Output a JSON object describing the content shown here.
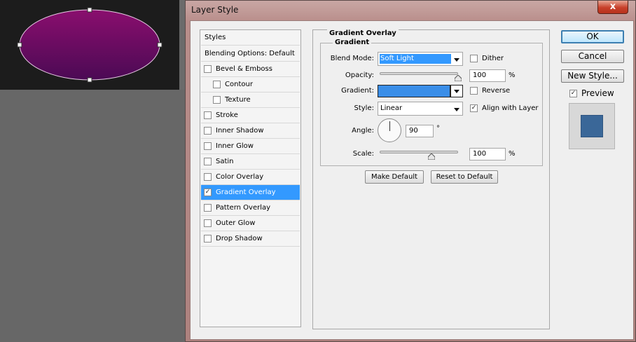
{
  "dialog": {
    "title": "Layer Style",
    "close_glyph": "x"
  },
  "sidebar": {
    "header": "Styles",
    "blending": "Blending Options: Default",
    "items": [
      {
        "label": "Bevel & Emboss",
        "checked": false,
        "indent": false
      },
      {
        "label": "Contour",
        "checked": false,
        "indent": true
      },
      {
        "label": "Texture",
        "checked": false,
        "indent": true
      },
      {
        "label": "Stroke",
        "checked": false,
        "indent": false
      },
      {
        "label": "Inner Shadow",
        "checked": false,
        "indent": false
      },
      {
        "label": "Inner Glow",
        "checked": false,
        "indent": false
      },
      {
        "label": "Satin",
        "checked": false,
        "indent": false
      },
      {
        "label": "Color Overlay",
        "checked": false,
        "indent": false
      },
      {
        "label": "Gradient Overlay",
        "checked": true,
        "indent": false,
        "selected": true
      },
      {
        "label": "Pattern Overlay",
        "checked": false,
        "indent": false
      },
      {
        "label": "Outer Glow",
        "checked": false,
        "indent": false
      },
      {
        "label": "Drop Shadow",
        "checked": false,
        "indent": false
      }
    ]
  },
  "panel": {
    "section_title": "Gradient Overlay",
    "group_title": "Gradient",
    "blend_mode_label": "Blend Mode:",
    "blend_mode_value": "Soft Light",
    "dither_label": "Dither",
    "opacity_label": "Opacity:",
    "opacity_value": "100",
    "opacity_percent": 100,
    "percent_sign": "%",
    "gradient_label": "Gradient:",
    "gradient_color": "#3a8ee8",
    "reverse_label": "Reverse",
    "style_label": "Style:",
    "style_value": "Linear",
    "align_label": "Align with Layer",
    "align_checked": true,
    "angle_label": "Angle:",
    "angle_value": "90",
    "degree_sign": "°",
    "scale_label": "Scale:",
    "scale_value": "100",
    "scale_percent": 100,
    "make_default": "Make Default",
    "reset_default": "Reset to Default"
  },
  "actions": {
    "ok": "OK",
    "cancel": "Cancel",
    "new_style": "New Style...",
    "preview_label": "Preview",
    "preview_checked": true,
    "preview_color": "#3a6798"
  },
  "canvas": {
    "shape_gradient_top": "#8a0e6e",
    "shape_gradient_bottom": "#4b0a54"
  },
  "check_glyph": "✓"
}
